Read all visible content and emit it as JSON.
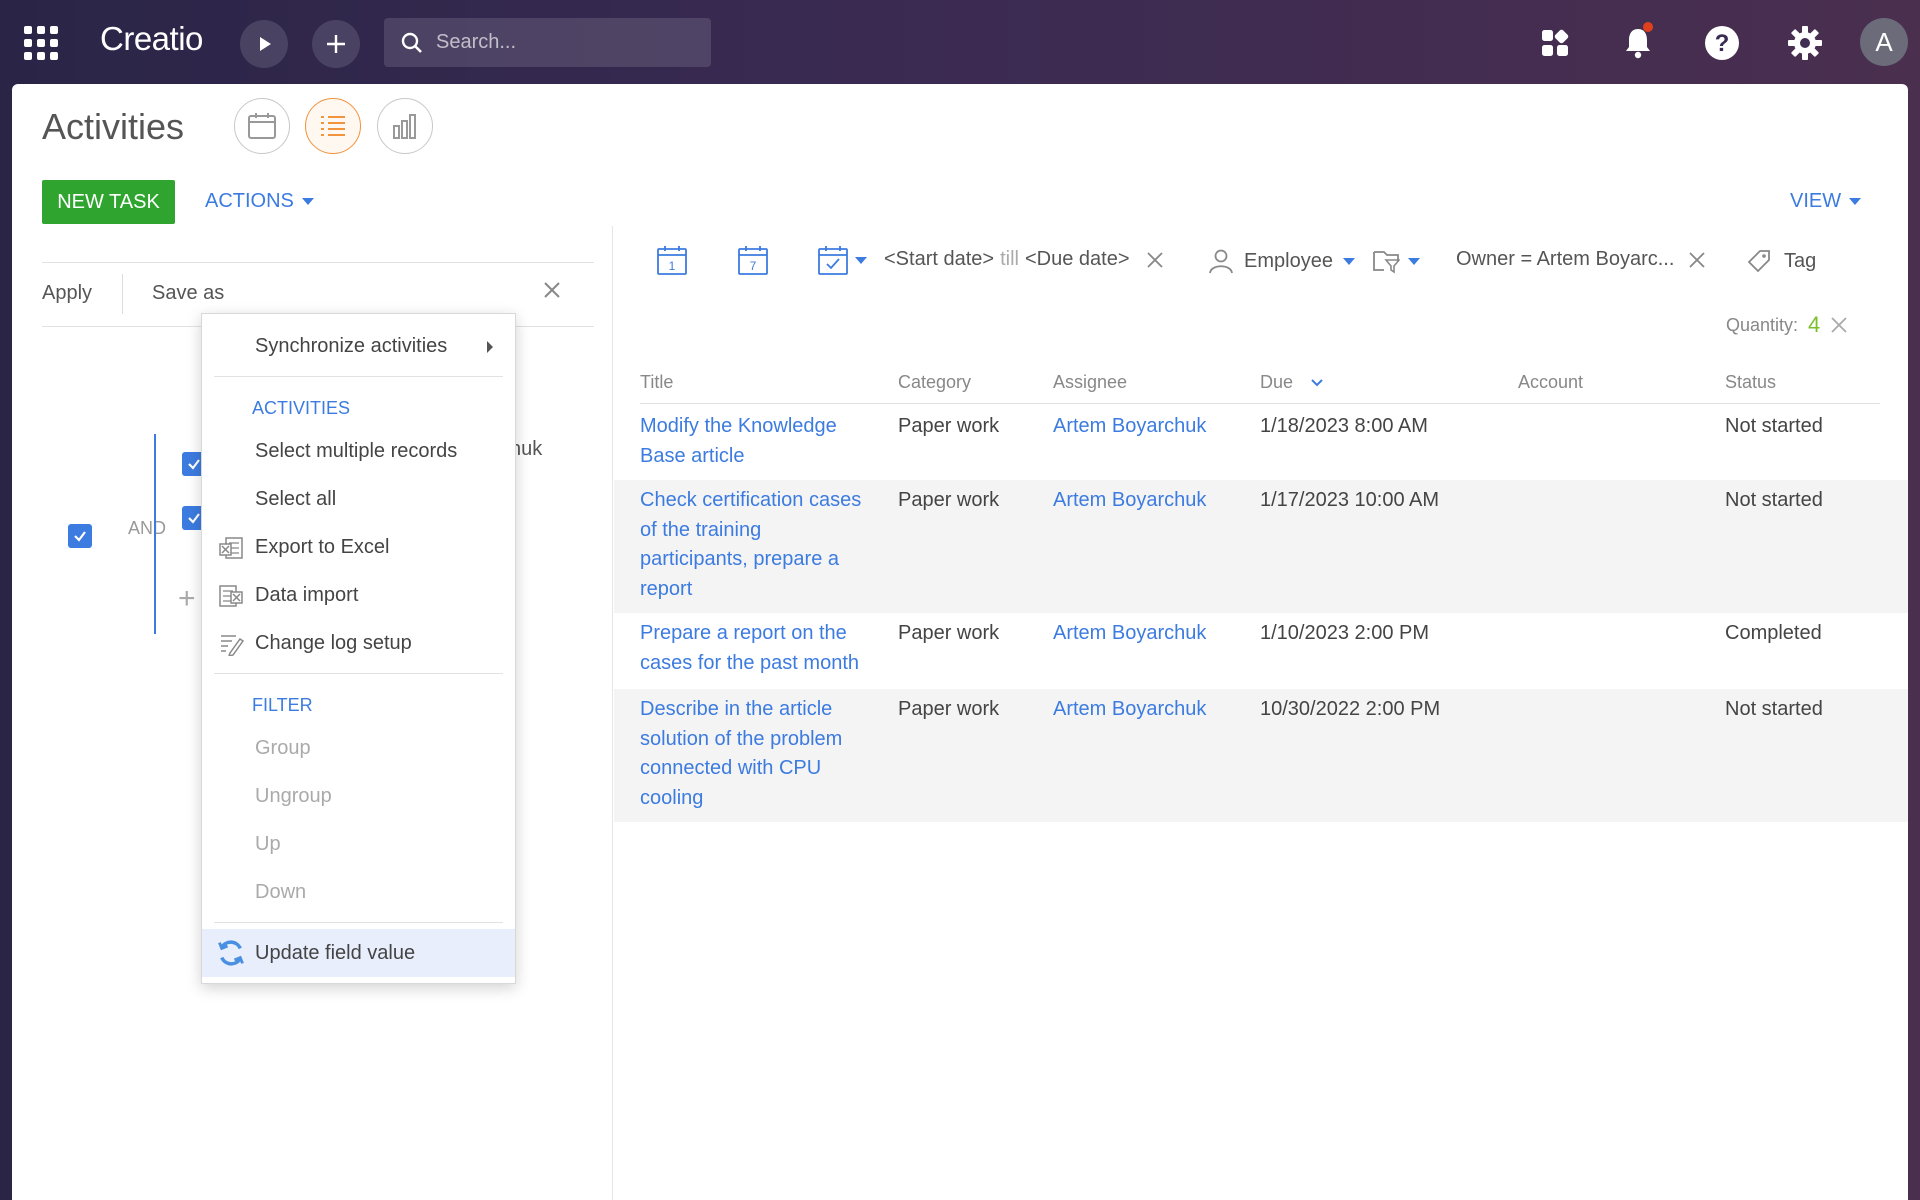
{
  "topbar": {
    "logo": "Creatio",
    "search_placeholder": "Search...",
    "avatar_letter": "A"
  },
  "page": {
    "title": "Activities"
  },
  "toolbar": {
    "new_task_label": "NEW TASK",
    "actions_label": "ACTIONS",
    "view_label": "VIEW"
  },
  "filter_panel": {
    "apply_label": "Apply",
    "save_as_label": "Save as",
    "and_label": "AND",
    "behind_text": "huk"
  },
  "actions_menu": {
    "sync_label": "Synchronize activities",
    "section_activities": "ACTIVITIES",
    "select_multiple": "Select multiple records",
    "select_all": "Select all",
    "export_excel": "Export to Excel",
    "data_import": "Data import",
    "change_log": "Change log setup",
    "section_filter": "FILTER",
    "group": "Group",
    "ungroup": "Ungroup",
    "up": "Up",
    "down": "Down",
    "update_field": "Update field value"
  },
  "grid_filters": {
    "start_date": "<Start date>",
    "till": "till",
    "due_date": "<Due date>",
    "employee_label": "Employee",
    "owner_filter": "Owner = Artem Boyarc...",
    "tag_label": "Tag",
    "quantity_label": "Quantity:",
    "quantity_value": "4"
  },
  "grid": {
    "columns": [
      "Title",
      "Category",
      "Assignee",
      "Due",
      "Account",
      "Status"
    ],
    "rows": [
      {
        "title": [
          "Modify the Knowledge",
          "Base article"
        ],
        "category": "Paper work",
        "assignee": "Artem Boyarchuk",
        "due": "1/18/2023 8:00 AM",
        "account": "",
        "status": "Not started"
      },
      {
        "title": [
          "Check certification cases",
          "of the training",
          "participants, prepare a",
          "report"
        ],
        "category": "Paper work",
        "assignee": "Artem Boyarchuk",
        "due": "1/17/2023 10:00 AM",
        "account": "",
        "status": "Not started"
      },
      {
        "title": [
          "Prepare a report on the",
          "cases for the past month"
        ],
        "category": "Paper work",
        "assignee": "Artem Boyarchuk",
        "due": "1/10/2023 2:00 PM",
        "account": "",
        "status": "Completed"
      },
      {
        "title": [
          "Describe in the article",
          "solution of the problem",
          "connected with CPU",
          "cooling"
        ],
        "category": "Paper work",
        "assignee": "Artem Boyarchuk",
        "due": "10/30/2022 2:00 PM",
        "account": "",
        "status": "Not started"
      }
    ]
  },
  "colors": {
    "accent_blue": "#3c7be0",
    "new_task_green": "#2fa52f",
    "active_view_orange": "#f2933e",
    "quantity_green": "#7bbf2a",
    "notification_red": "#e0411c"
  }
}
